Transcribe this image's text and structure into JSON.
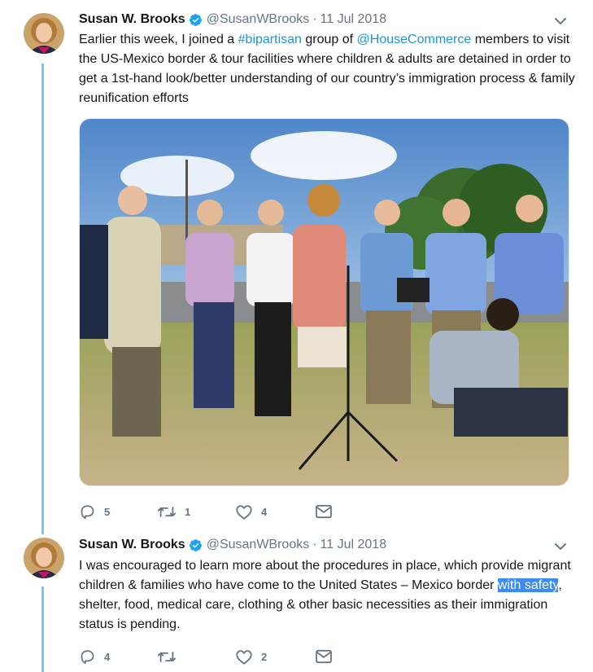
{
  "tweets": [
    {
      "author_name": "Susan W. Brooks",
      "handle": "@SusanWBrooks",
      "separator": "·",
      "date": "11 Jul 2018",
      "text_parts": {
        "p1": "Earlier this week, I joined a ",
        "hashtag": "#bipartisan",
        "p2": " group of ",
        "mention": "@HouseCommerce",
        "p3": " members to visit the US-Mexico border & tour facilities where children & adults are detained in order to get a 1st-hand look/better understanding of our country’s immigration process & family reunification efforts"
      },
      "actions": {
        "replies": "5",
        "retweets": "1",
        "likes": "4"
      }
    },
    {
      "author_name": "Susan W. Brooks",
      "handle": "@SusanWBrooks",
      "separator": "·",
      "date": "11 Jul 2018",
      "text_parts": {
        "p1": "I was encouraged to learn more about the procedures in place, which provide migrant children & families who have come to the United States – Mexico border ",
        "selected": "with safety",
        "p2": ", shelter, food, medical care, clothing & other basic necessities as their immigration status is pending."
      },
      "actions": {
        "replies": "4",
        "retweets": "",
        "likes": "2"
      }
    }
  ],
  "colors": {
    "link": "#1b95e0",
    "verified": "#1da1f2",
    "thread_line": "#7fc4ea",
    "selection": "#3b8cf5",
    "meta": "#657786"
  },
  "icons": {
    "reply": "reply-icon",
    "retweet": "retweet-icon",
    "like": "heart-icon",
    "message": "envelope-icon",
    "verified": "verified-badge-icon",
    "caret": "chevron-down-icon"
  }
}
